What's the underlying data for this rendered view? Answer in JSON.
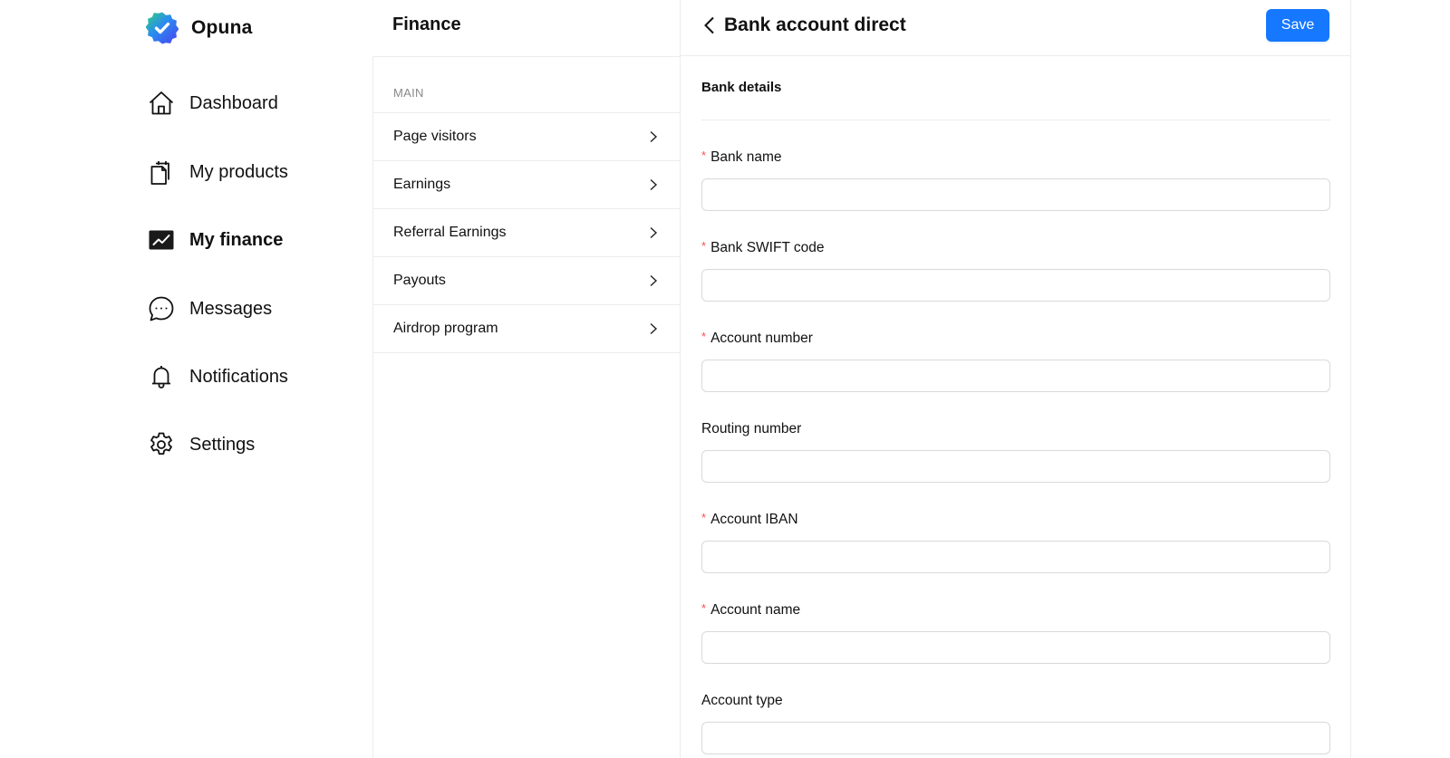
{
  "app": {
    "name": "Opuna",
    "logo_icon": "verified-badge-icon",
    "accent_color": "#1677ff",
    "required_color": "#ff4d4f"
  },
  "nav": {
    "items": [
      {
        "label": "Dashboard",
        "icon": "home-icon",
        "active": false
      },
      {
        "label": "My products",
        "icon": "clipboard-icon",
        "active": false
      },
      {
        "label": "My finance",
        "icon": "chart-line-icon",
        "active": true
      },
      {
        "label": "Messages",
        "icon": "chat-bubble-icon",
        "active": false
      },
      {
        "label": "Notifications",
        "icon": "bell-icon",
        "active": false
      },
      {
        "label": "Settings",
        "icon": "gear-icon",
        "active": false
      }
    ]
  },
  "finance": {
    "title": "Finance",
    "section_label": "MAIN",
    "items": [
      {
        "label": "Page visitors",
        "icon": "chevron-right-icon"
      },
      {
        "label": "Earnings",
        "icon": "chevron-right-icon"
      },
      {
        "label": "Referral Earnings",
        "icon": "chevron-right-icon"
      },
      {
        "label": "Payouts",
        "icon": "chevron-right-icon"
      },
      {
        "label": "Airdrop program",
        "icon": "chevron-right-icon"
      }
    ]
  },
  "detail": {
    "back_icon": "chevron-left-icon",
    "title": "Bank account direct",
    "save_label": "Save",
    "section_title": "Bank details",
    "required_marker": "*",
    "fields": [
      {
        "label": "Bank name",
        "required": true,
        "value": "",
        "placeholder": ""
      },
      {
        "label": "Bank SWIFT code",
        "required": true,
        "value": "",
        "placeholder": ""
      },
      {
        "label": "Account number",
        "required": true,
        "value": "",
        "placeholder": ""
      },
      {
        "label": "Routing number",
        "required": false,
        "value": "",
        "placeholder": ""
      },
      {
        "label": "Account IBAN",
        "required": true,
        "value": "",
        "placeholder": ""
      },
      {
        "label": "Account name",
        "required": true,
        "value": "",
        "placeholder": ""
      },
      {
        "label": "Account type",
        "required": false,
        "value": "",
        "placeholder": ""
      }
    ]
  }
}
